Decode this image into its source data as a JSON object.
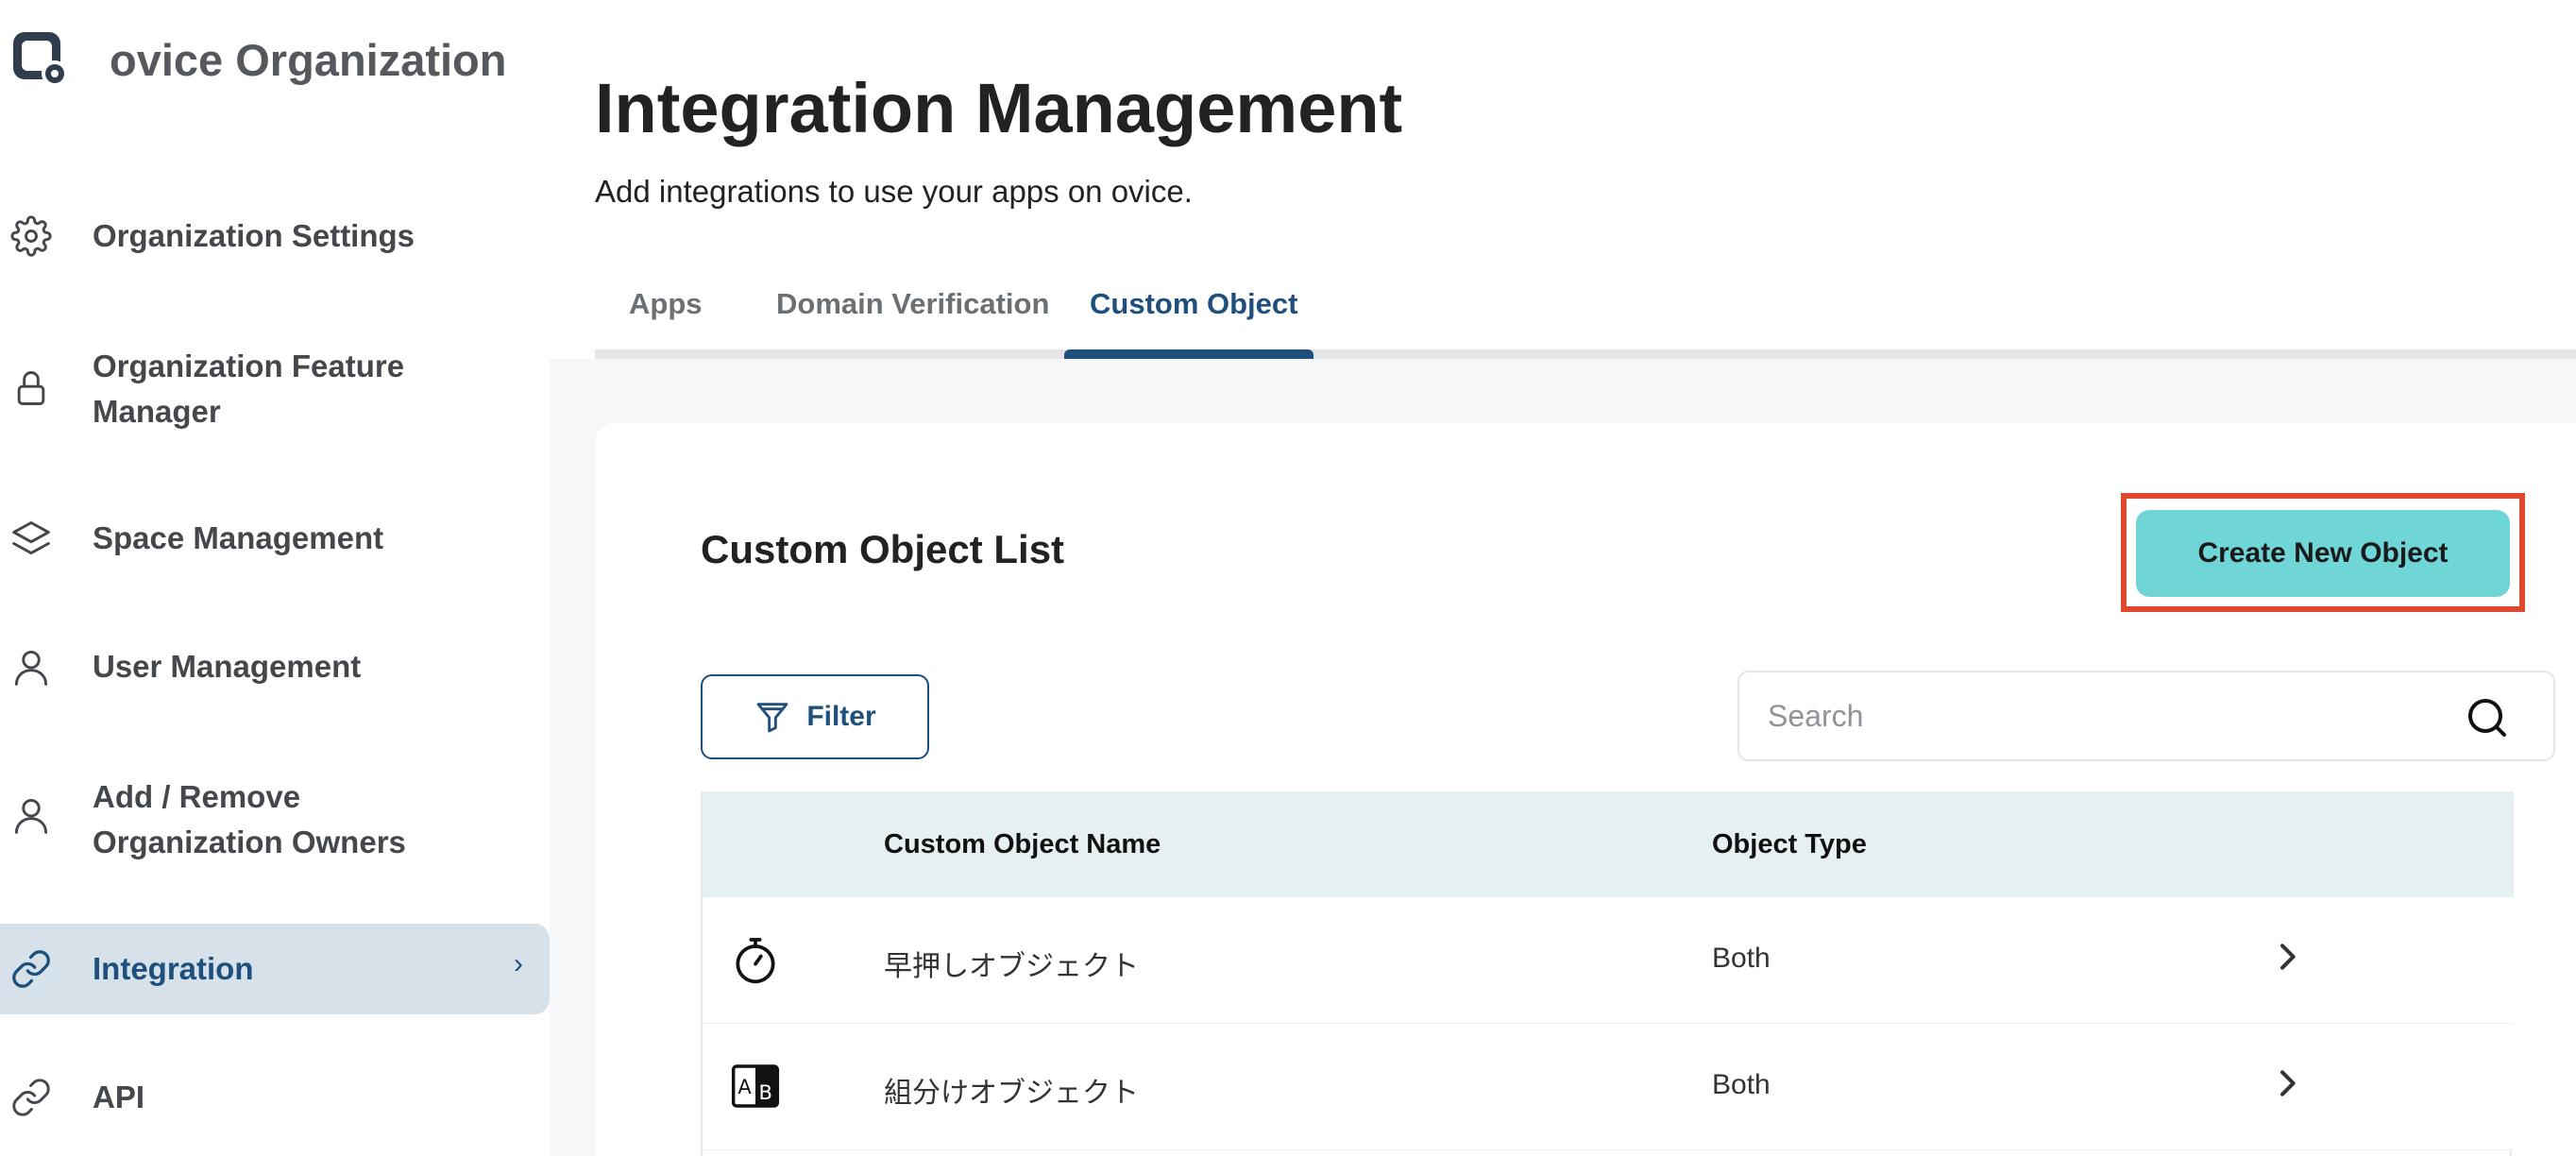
{
  "sidebar": {
    "org_name": "ovice Organization",
    "items": [
      {
        "label": "Organization Settings",
        "icon": "gear-icon"
      },
      {
        "label": "Organization Feature\nManager",
        "icon": "lock-icon"
      },
      {
        "label": "Space Management",
        "icon": "layers-icon"
      },
      {
        "label": "User Management",
        "icon": "user-icon"
      },
      {
        "label": "Add / Remove\nOrganization Owners",
        "icon": "user-icon"
      },
      {
        "label": "Integration",
        "icon": "link-icon",
        "active": true
      },
      {
        "label": "API",
        "icon": "link-icon"
      }
    ]
  },
  "header": {
    "title": "Integration Management",
    "subtitle": "Add integrations to use your apps on ovice."
  },
  "tabs": [
    {
      "label": "Apps"
    },
    {
      "label": "Domain Verification"
    },
    {
      "label": "Custom Object",
      "active": true
    }
  ],
  "list": {
    "title": "Custom Object List",
    "create_label": "Create New Object",
    "filter_label": "Filter",
    "search_placeholder": "Search",
    "columns": [
      "Custom Object Name",
      "Object Type"
    ],
    "rows": [
      {
        "icon": "stopwatch-icon",
        "name": "早押しオブジェクト",
        "type": "Both"
      },
      {
        "icon": "ab-split-icon",
        "name": "組分けオブジェクト",
        "type": "Both"
      }
    ]
  },
  "colors": {
    "accent": "#1e4f7d",
    "active_bg": "#d6e1ea",
    "button": "#6fd5d6",
    "highlight": "#e0472f",
    "table_header": "#e6eff2"
  }
}
